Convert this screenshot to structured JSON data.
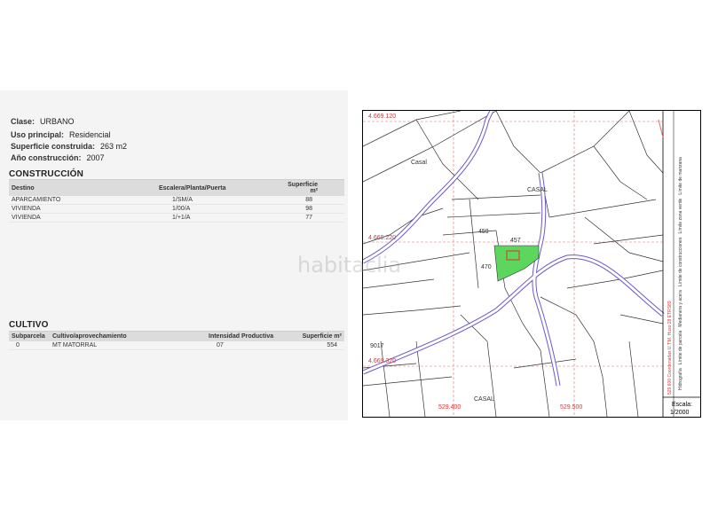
{
  "property": {
    "clase_label": "Clase:",
    "clase_value": "URBANO",
    "uso_label": "Uso principal:",
    "uso_value": "Residencial",
    "superficie_label": "Superficie construida:",
    "superficie_value": "263 m2",
    "anio_label": "Año construcción:",
    "anio_value": "2007"
  },
  "construccion": {
    "title": "CONSTRUCCIÓN",
    "headers": [
      "Destino",
      "Escalera/Planta/Puerta",
      "Superficie m²"
    ],
    "rows": [
      [
        "APARCAMIENTO",
        "1/SM/A",
        "88"
      ],
      [
        "VIVIENDA",
        "1/00/A",
        "98"
      ],
      [
        "VIVIENDA",
        "1/+1/A",
        "77"
      ]
    ]
  },
  "cultivo": {
    "title": "CULTIVO",
    "headers": [
      "Subparcela",
      "Cultivo/aprovechamiento",
      "Intensidad Productiva",
      "Superficie m²"
    ],
    "rows": [
      [
        "0",
        "MT MATORRAL",
        "07",
        "554"
      ]
    ]
  },
  "map": {
    "coord_top": "4.669.120",
    "coord_mid": "4.669.220",
    "coord_bottom": "4.669.320",
    "coord_x1": "529.400",
    "coord_x2": "529.500",
    "label_casal_1": "Casal",
    "label_casal_2": "CASAL",
    "label_casal_3": "CASAL",
    "parcel_459": "459",
    "parcel_457": "457",
    "parcel_470": "470",
    "parcel_9017": "9017",
    "scale_label": "Escala:",
    "scale_value": "1/2000",
    "legend": [
      "Hidrografía",
      "Límite de parcela",
      "Medianera y acera",
      "Límite de construcciones",
      "Límite zona verde",
      "Límite de manzana"
    ],
    "projection_note": "529.600 Coordenadas U.T.M. Huso 28 ETRS89",
    "watermark": "habitaclia",
    "colors": {
      "highlight": "#5cd65c",
      "road": "#6a5acd",
      "grid": "#e07070"
    }
  }
}
